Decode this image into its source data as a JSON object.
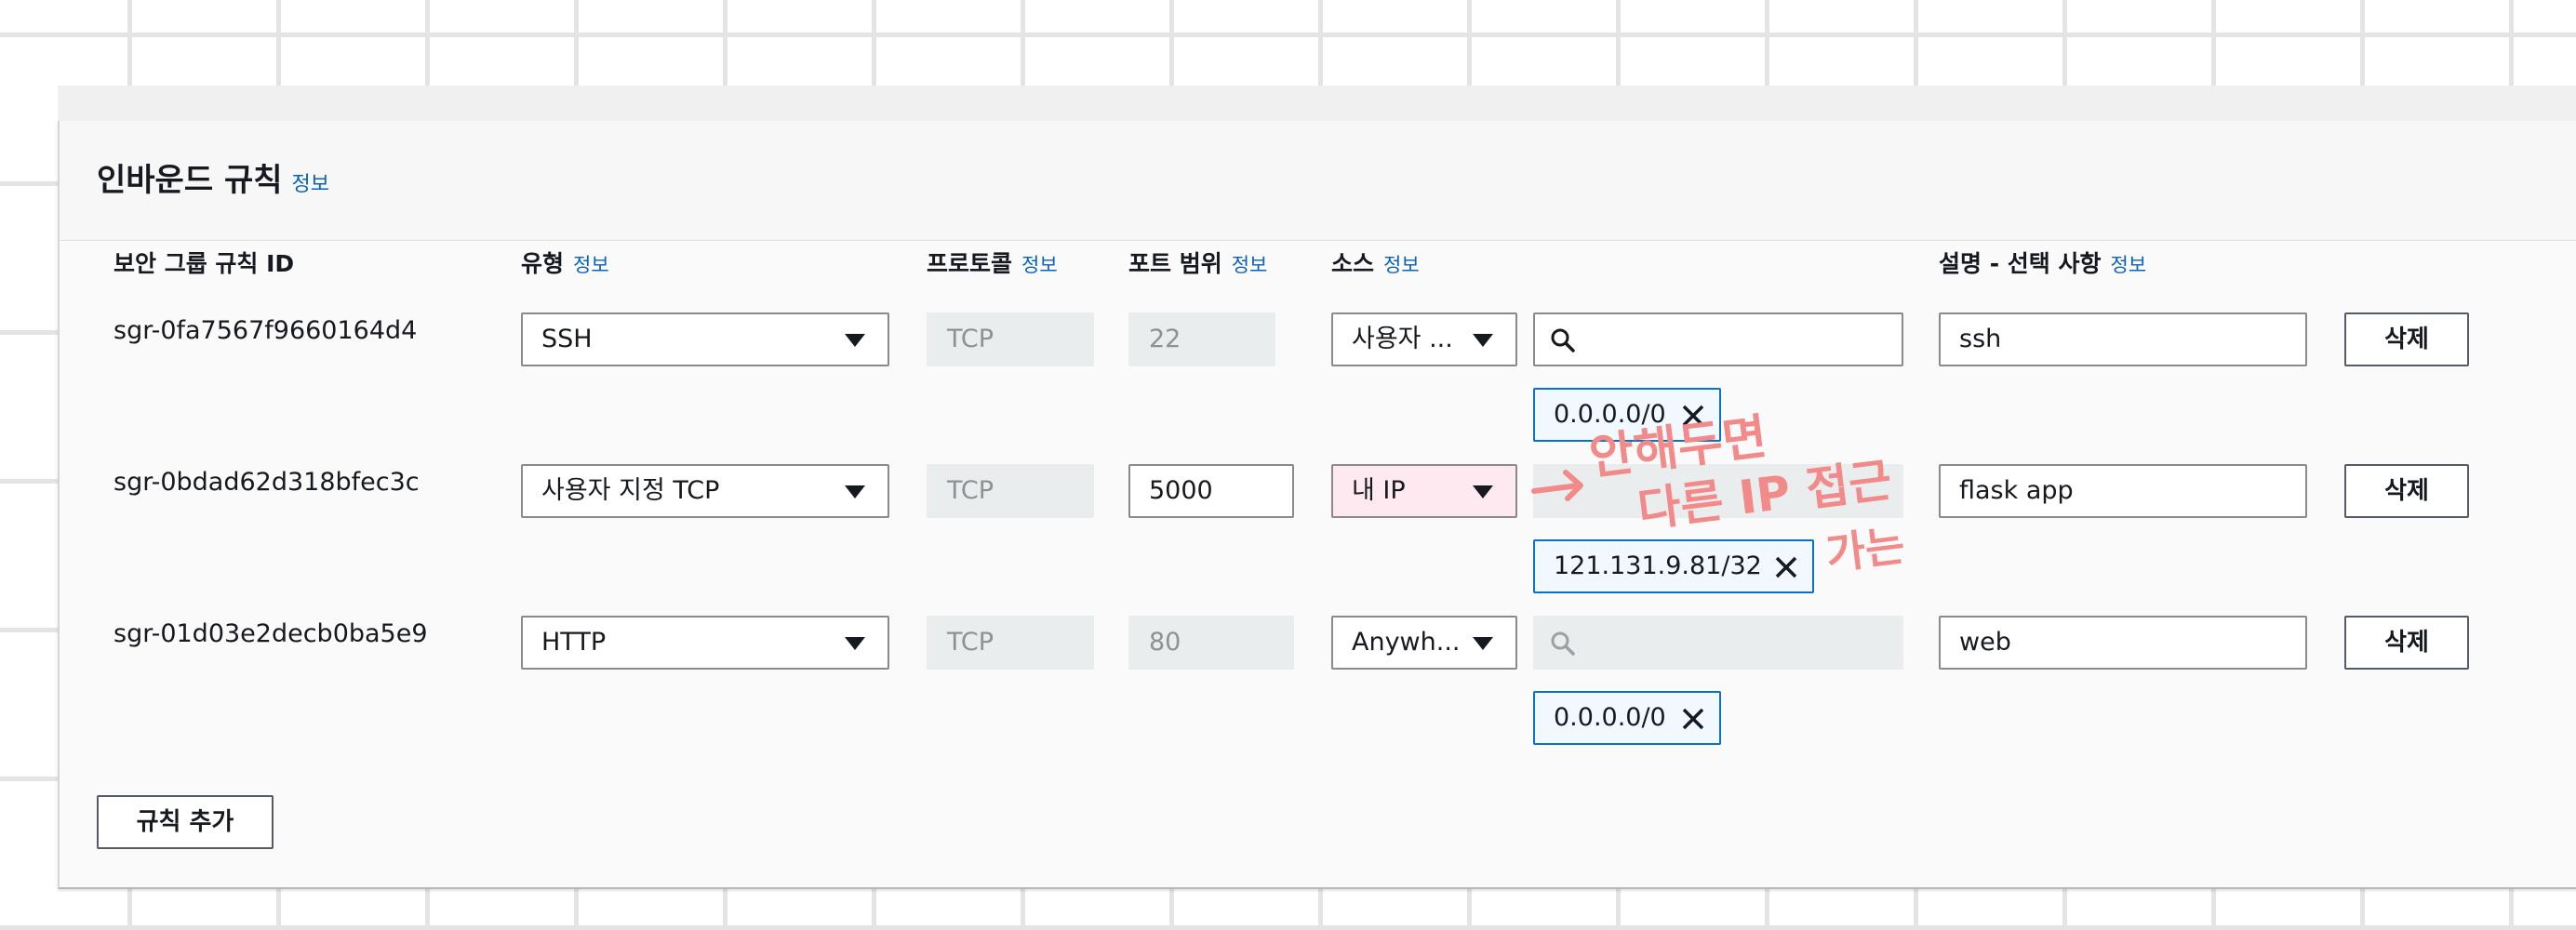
{
  "section": {
    "title": "인바운드 규칙",
    "info": "정보"
  },
  "columns": {
    "rule_id": "보안 그룹 규칙 ID",
    "type": "유형",
    "type_info": "정보",
    "protocol": "프로토콜",
    "protocol_info": "정보",
    "port": "포트 범위",
    "port_info": "정보",
    "source": "소스",
    "source_info": "정보",
    "desc": "설명 - 선택 사항",
    "desc_info": "정보"
  },
  "rules": [
    {
      "id": "sgr-0fa7567f9660164d4",
      "type": "SSH",
      "protocol": "TCP",
      "port": "22",
      "source": "사용자 ...",
      "cidr": "0.0.0.0/0",
      "description": "ssh",
      "delete": "삭제"
    },
    {
      "id": "sgr-0bdad62d318bfec3c",
      "type": "사용자 지정 TCP",
      "protocol": "TCP",
      "port": "5000",
      "source": "내 IP",
      "cidr": "121.131.9.81/32",
      "description": "flask app",
      "delete": "삭제"
    },
    {
      "id": "sgr-01d03e2decb0ba5e9",
      "type": "HTTP",
      "protocol": "TCP",
      "port": "80",
      "source": "Anywh...",
      "cidr": "0.0.0.0/0",
      "description": "web",
      "delete": "삭제"
    }
  ],
  "add_rule": "규칙 추가",
  "annotation": {
    "line1": "안해두면",
    "line2": "다른 IP 접근",
    "line3": "가는",
    "color": "#f28a8a"
  },
  "colors": {
    "link": "#0a62b3",
    "token_border": "#0a72c6",
    "token_bg": "#f1f8ff"
  },
  "icons": [
    "caret-down-icon",
    "search-icon",
    "close-icon",
    "arrow-right-icon"
  ]
}
